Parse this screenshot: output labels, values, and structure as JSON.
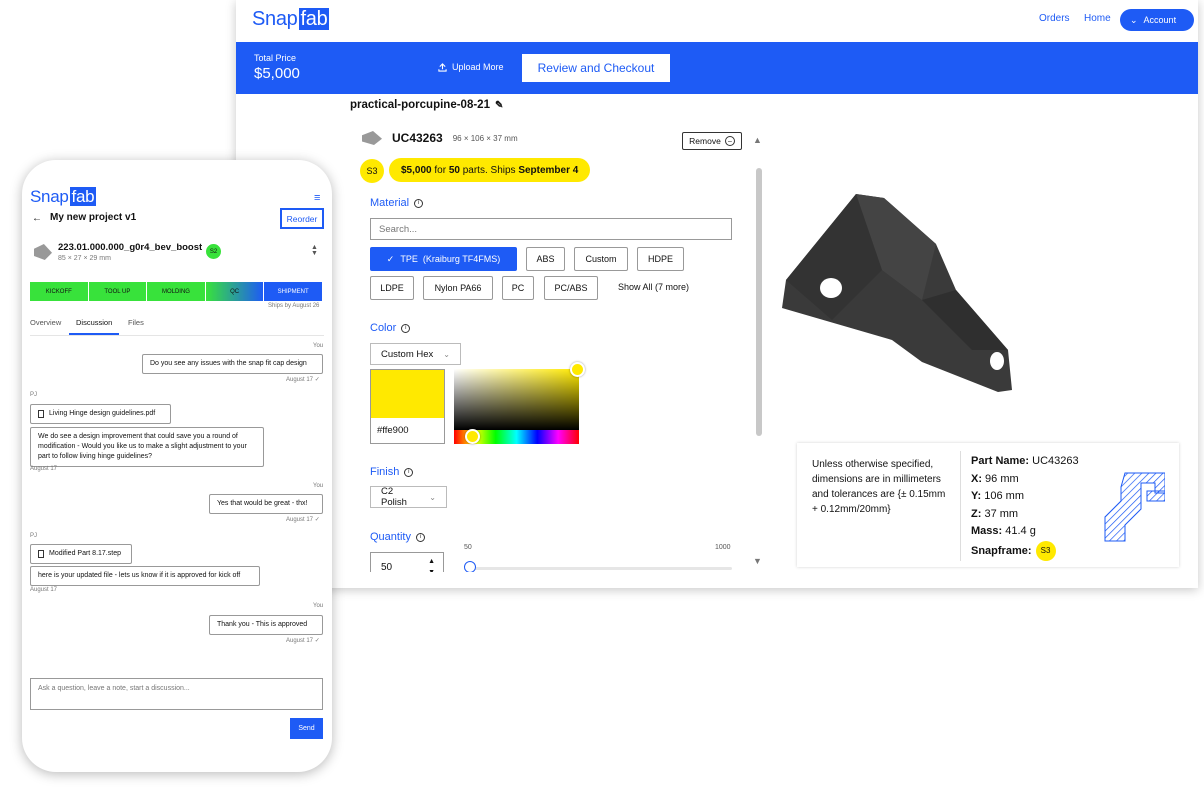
{
  "brand": {
    "name_a": "Snap",
    "name_b": "fab",
    "accent": "#1e5bf5",
    "highlight": "#ffe900",
    "status_green": "#38e23b"
  },
  "desktop": {
    "nav": {
      "orders": "Orders",
      "home": "Home",
      "account": "Account"
    },
    "total_price_label": "Total Price",
    "total_price_value": "$5,000",
    "upload_more": "Upload More",
    "review_checkout": "Review and  Checkout",
    "project_name": "practical-porcupine-08-21",
    "part": {
      "id": "UC43263",
      "dims": "96 × 106 × 37 mm",
      "remove": "Remove",
      "badge": "S3"
    },
    "price_pill": {
      "price": "$5,000",
      "for": " for ",
      "qty": "50",
      "parts": " parts. Ships ",
      "date": "September 4"
    },
    "material": {
      "label": "Material",
      "search_placeholder": "Search...",
      "options": [
        "TPE  (Kraiburg TF4FMS)",
        "ABS",
        "Custom",
        "HDPE",
        "LDPE",
        "Nylon PA66",
        "PC",
        "PC/ABS"
      ],
      "selected": "TPE  (Kraiburg TF4FMS)",
      "show_all": "Show All (7 more)"
    },
    "color": {
      "label": "Color",
      "mode": "Custom Hex",
      "hex": "#ffe900"
    },
    "finish": {
      "label": "Finish",
      "value": "C2 Polish"
    },
    "quantity": {
      "label": "Quantity",
      "value": "50",
      "min": "50",
      "max": "1000",
      "level": 0
    },
    "specs": {
      "note": "Unless otherwise specified, dimensions are in millimeters and tolerances are {± 0.15mm + 0.12mm/20mm}",
      "part_name_label": "Part Name:",
      "part_name": " UC43263",
      "x_label": "X:",
      "x": " 96 mm",
      "y_label": "Y:",
      "y": " 106 mm",
      "z_label": "Z:",
      "z": " 37 mm",
      "mass_label": "Mass:",
      "mass": " 41.4 g",
      "snapframe_label": "Snapframe:",
      "snapframe": "S3"
    }
  },
  "mobile": {
    "project_title": "My new project v1",
    "reorder": "Reorder",
    "part": {
      "name": "223.01.000.000_g0r4_bev_boost",
      "dims": "85 × 27 × 29 mm",
      "badge": "S2"
    },
    "stages": [
      "KICKOFF",
      "TOOL UP",
      "MOLDING",
      "QC",
      "SHIPMENT"
    ],
    "ships_by": "Ships by August 26",
    "tabs": [
      "Overview",
      "Discussion",
      "Files"
    ],
    "active_tab": "Discussion",
    "messages": {
      "m1_who": "You",
      "m1": "Do you see any issues with the snap fit cap design",
      "m1_date": "August 17",
      "m2_who": "PJ",
      "m2_file": "Living Hinge design guidelines.pdf",
      "m2": "We do see a design improvement that could save you a round of modification - Would you like us to make a slight adjustment to your part to follow living hinge guidelines?",
      "m2_date": "August 17",
      "m3_who": "You",
      "m3": "Yes that would be great - thx!",
      "m3_date": "August 17",
      "m4_who": "PJ",
      "m4_file": "Modified Part 8.17.step",
      "m4": "here is your updated file - lets us know if it is approved for kick off",
      "m4_date": "August 17",
      "m5_who": "You",
      "m5": "Thank you - This is approved",
      "m5_date": "August 17"
    },
    "ask_placeholder": "Ask a question, leave a note, start a discussion...",
    "send": "Send"
  }
}
